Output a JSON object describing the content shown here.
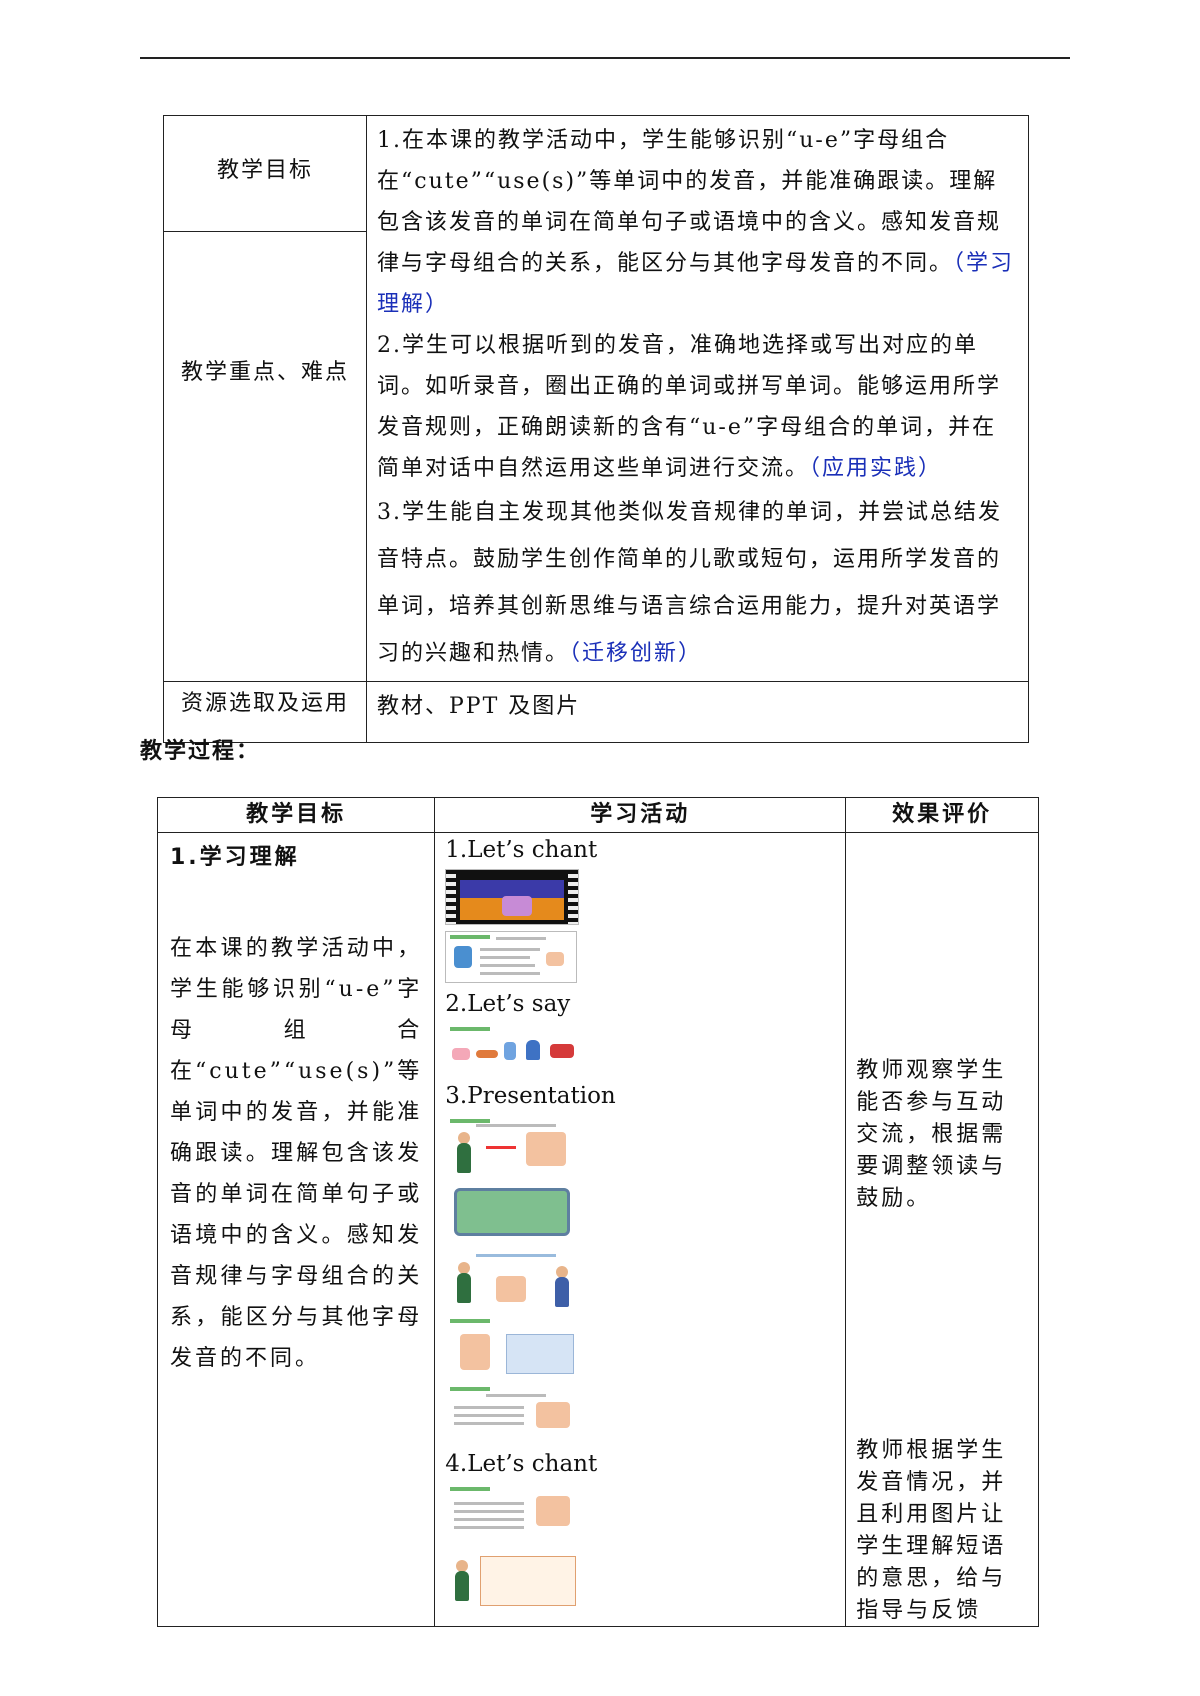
{
  "table1": {
    "row1_label": "教学目标",
    "row2_label": "教学重点、难点",
    "goals": [
      {
        "text": "1.在本课的教学活动中，学生能够识别“u-e”字母组合在“cute”“use(s)”等单词中的发音，并能准确跟读。理解包含该发音的单词在简单句子或语境中的含义。感知发音规律与字母组合的关系，能区分与其他字母发音的不同。",
        "tag": "（学习理解）"
      },
      {
        "text": "2.学生可以根据听到的发音，准确地选择或写出对应的单词。如听录音，圈出正确的单词或拼写单词。能够运用所学发音规则，正确朗读新的含有“u-e”字母组合的单词，并在简单对话中自然运用这些单词进行交流。",
        "tag": "（应用实践）"
      },
      {
        "text": "3.学生能自主发现其他类似发音规律的单词，并尝试总结发音特点。鼓励学生创作简单的儿歌或短句，运用所学发音的单词，培养其创新思维与语言综合运用能力，提升对英语学习的兴趣和热情。",
        "tag": "（迁移创新）"
      }
    ],
    "resource_label": "资源选取及运用",
    "resource_value": "教材、PPT 及图片"
  },
  "section_title": "教学过程：",
  "table2": {
    "headers": [
      "教学目标",
      "学习活动",
      "效果评价"
    ],
    "goal_head": "1.学习理解",
    "goal_body": "在本课的教学活动中，学生能够识别“u-e”字母组合在“cute”“use(s)”等单词中的发音，并能准确跟读。理解包含该发音的单词在简单句子或语境中的含义。感知发音规律与字母组合的关系，能区分与其他字母发音的不同。",
    "activities": [
      "1.Let’s chant",
      "2.Let’s say",
      "3.Presentation",
      "4.Let’s chant"
    ],
    "eval1": "教师观察学生能否参与互动交流，根据需要调整领读与鼓励。",
    "eval2": "教师根据学生发音情况，并且利用图片让学生理解短语的意思，给与指导与反馈"
  }
}
